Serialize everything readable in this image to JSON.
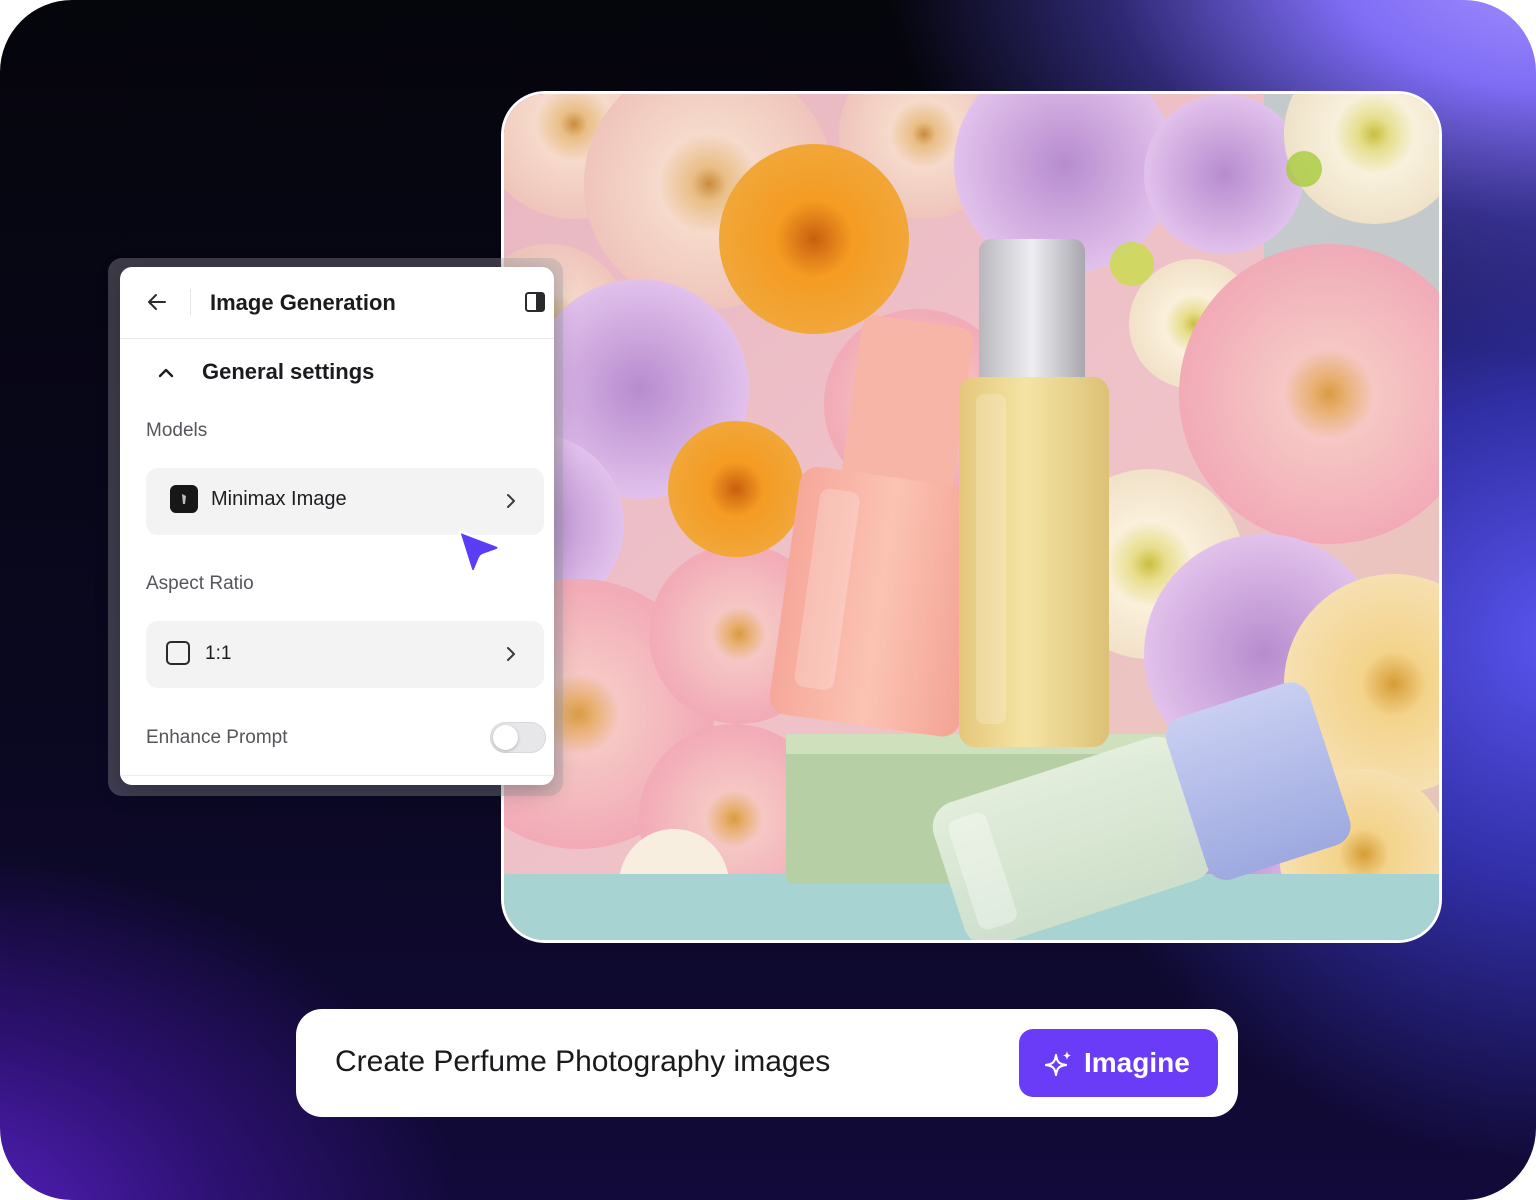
{
  "panel": {
    "title": "Image Generation",
    "section_title": "General settings",
    "models_label": "Models",
    "model_value": "Minimax Image",
    "aspect_label": "Aspect Ratio",
    "aspect_value": "1:1",
    "enhance_label": "Enhance Prompt",
    "enhance_enabled": false
  },
  "prompt": {
    "text": "Create Perfume Photography images",
    "button_label": "Imagine"
  },
  "colors": {
    "accent": "#6a3cf8",
    "cursor": "#5b3df5"
  },
  "icons": [
    "back-arrow-icon",
    "sidebar-toggle-icon",
    "chevron-up-icon",
    "model-logo-icon",
    "chevron-right-icon",
    "square-ratio-icon",
    "pointer-cursor-icon",
    "sparkle-icon"
  ]
}
